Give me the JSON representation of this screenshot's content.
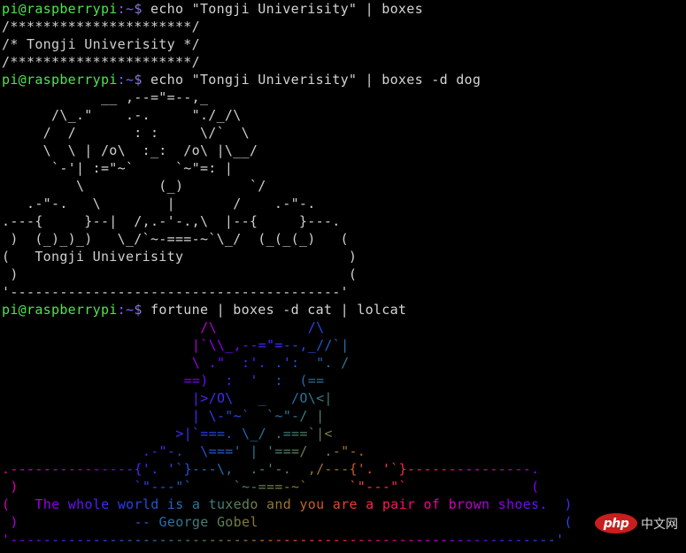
{
  "terminal": {
    "background_color": "#000000",
    "default_text_color": "#cdcdcd",
    "prompt": {
      "user_host": "pi@raspberrypi",
      "user_host_color": "#4ee44e",
      "path": ":~",
      "path_color": "#6a6aff",
      "dollar": "$",
      "dollar_color": "#8a7ad8"
    },
    "commands": [
      {
        "text": " echo \"Tongji Univerisity\" | boxes"
      },
      {
        "text": " echo \"Tongji Univerisity\" | boxes -d dog"
      },
      {
        "text": " fortune | boxes -d cat | lolcat"
      }
    ],
    "block1_boxes_output": [
      "/**********************/",
      "/* Tongji Univerisity */",
      "/**********************/"
    ],
    "block2_dog_output": [
      "            __        _,--=\"=--,_",
      "       /\\_.\"     .\"       \".\"/_/\\",
      "      /  /         :   :       \\/  \\",
      "      \\  \\  | /o\\   :_:   /o\\ |\\__/",
      "       `-'|  :=\"~`       `~\"=:  |",
      "          \\          (_)         `/",
      "    .-\"-.    \\         |          /    .-\"-.",
      ".---{      }--|  /,.-'-.,\\  |--{      }---.",
      " )   (_)_)_)   \\_/`~-===-~`\\_/   (_(_(_)   (",
      "(   Tongji Univerisity                      )",
      " )                                          (",
      "'--------------------------------------------'"
    ],
    "block3_cat_output": [
      "                 /\\             /\\",
      "                |`\\\\_,--=\"=--,_//`|",
      "                \\ .\"  :'. .':  \". /",
      "               ==)  :  '  :  (==",
      "                 |>/O\\   _   /O\\<|",
      "                 | \\-\"~`  `~\"-/ |",
      "                >|`===. \\_/ .===`|<",
      "            .-\"-.   \\===' | '===/   .-\"-.",
      ".----------{'. '`}---\\,   .-'-.   ,/---{'. '`}----------.",
      " )`\"---\"`      `~-===-~`      `\"---\"`                  (",
      "(   The whole world is a tuxedo and you are a pair of brown shoes.   )",
      " )              -- George Gobel                                      (",
      "'-------------------------------------------------------------------'"
    ],
    "quote": {
      "text": "The whole world is a tuxedo and you are a pair of brown shoes.",
      "attribution": "-- George Gobel"
    },
    "lolcat_palette": [
      "#ff2d7a",
      "#ff2f5e",
      "#f43255",
      "#e0335f",
      "#cc3470",
      "#b83585",
      "#a13699",
      "#8a37ad",
      "#7038bd",
      "#5639cb",
      "#3f3ad6",
      "#2f3ce0",
      "#3a49ea",
      "#4a5cf0",
      "#5a70f5"
    ]
  },
  "watermark": {
    "logo_text": "php",
    "logo_color": "#c81e1e",
    "suffix_text": "中文网"
  }
}
